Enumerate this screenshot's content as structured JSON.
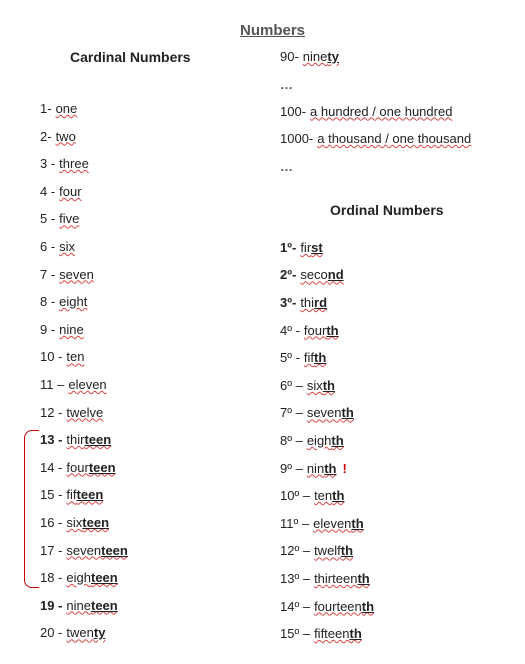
{
  "title": "Numbers",
  "cardinal": {
    "heading": "Cardinal Numbers",
    "items": [
      {
        "n": "1",
        "sep": "- ",
        "pre": "",
        "emph": "",
        "post": "one",
        "bold_num": false
      },
      {
        "n": "2",
        "sep": "- ",
        "pre": "",
        "emph": "",
        "post": "two",
        "bold_num": false
      },
      {
        "n": "3",
        "sep": " - ",
        "pre": "",
        "emph": "",
        "post": "three",
        "bold_num": false
      },
      {
        "n": "4",
        "sep": " - ",
        "pre": "",
        "emph": "",
        "post": "four",
        "bold_num": false
      },
      {
        "n": "5",
        "sep": " - ",
        "pre": "",
        "emph": "",
        "post": "five",
        "bold_num": false
      },
      {
        "n": "6",
        "sep": " - ",
        "pre": "",
        "emph": "",
        "post": "six",
        "bold_num": false
      },
      {
        "n": "7",
        "sep": " - ",
        "pre": "",
        "emph": "",
        "post": "seven",
        "bold_num": false
      },
      {
        "n": "8",
        "sep": " - ",
        "pre": "",
        "emph": "",
        "post": "eight",
        "bold_num": false
      },
      {
        "n": "9",
        "sep": " - ",
        "pre": "",
        "emph": "",
        "post": "nine",
        "bold_num": false
      },
      {
        "n": "10",
        "sep": " - ",
        "pre": "",
        "emph": "",
        "post": "ten",
        "bold_num": false
      },
      {
        "n": "11",
        "sep": " – ",
        "pre": "",
        "emph": "",
        "post": "eleven",
        "bold_num": false
      },
      {
        "n": "12",
        "sep": " - ",
        "pre": "",
        "emph": "",
        "post": "twelve",
        "bold_num": false
      },
      {
        "n": "13",
        "sep": " -",
        "pre": "thir",
        "emph": "teen",
        "post": "",
        "bold_num": true
      },
      {
        "n": "14",
        "sep": " - ",
        "pre": "four",
        "emph": "teen",
        "post": "",
        "bold_num": false
      },
      {
        "n": "15",
        "sep": " - ",
        "pre": "fif",
        "emph": "teen",
        "post": "",
        "bold_num": false
      },
      {
        "n": "16",
        "sep": " - ",
        "pre": "six",
        "emph": "teen",
        "post": "",
        "bold_num": false
      },
      {
        "n": "17",
        "sep": " - ",
        "pre": "seven",
        "emph": "teen",
        "post": "",
        "bold_num": false
      },
      {
        "n": "18",
        "sep": " - ",
        "pre": "eigh",
        "emph": "teen",
        "post": "",
        "bold_num": false
      },
      {
        "n": "19",
        "sep": " - ",
        "pre": "nine",
        "emph": "teen",
        "post": "",
        "bold_num": true
      },
      {
        "n": "20",
        "sep": " - ",
        "pre": "twen",
        "emph": "ty",
        "post": "",
        "bold_num": false
      }
    ]
  },
  "cardinal_extra": {
    "items": [
      {
        "n": "90",
        "sep": "- ",
        "pre": "nine",
        "emph": "ty",
        "post": "",
        "bold_num": false
      },
      {
        "ellipsis": "…"
      },
      {
        "n": "100",
        "sep": "- ",
        "pre": "",
        "emph": "",
        "post": "a hundred / one hundred",
        "bold_num": false
      },
      {
        "n": "1000",
        "sep": "- ",
        "pre": "",
        "emph": "",
        "post": "a thousand / one thousand",
        "bold_num": false
      },
      {
        "ellipsis": "…"
      }
    ]
  },
  "ordinal": {
    "heading": "Ordinal Numbers",
    "items": [
      {
        "n": "1º",
        "sep": "- ",
        "pre": "fir",
        "emph": "st",
        "post": "",
        "bold_num": true,
        "exclaim": false
      },
      {
        "n": "2º",
        "sep": "- ",
        "pre": "seco",
        "emph": "nd",
        "post": "",
        "bold_num": true,
        "exclaim": false
      },
      {
        "n": "3º",
        "sep": "- ",
        "pre": "thi",
        "emph": "rd",
        "post": "",
        "bold_num": true,
        "exclaim": false
      },
      {
        "n": "4º",
        "sep": " - ",
        "pre": "four",
        "emph": "th",
        "post": "",
        "bold_num": false,
        "exclaim": false
      },
      {
        "n": "5º",
        "sep": " - ",
        "pre": "fif",
        "emph": "th",
        "post": "",
        "bold_num": false,
        "exclaim": false
      },
      {
        "n": "6º",
        "sep": " – ",
        "pre": "six",
        "emph": "th",
        "post": "",
        "bold_num": false,
        "exclaim": false
      },
      {
        "n": "7º",
        "sep": " – ",
        "pre": "seven",
        "emph": "th",
        "post": "",
        "bold_num": false,
        "exclaim": false
      },
      {
        "n": "8º",
        "sep": " – ",
        "pre": "eigh",
        "emph": "th",
        "post": "",
        "bold_num": false,
        "exclaim": false
      },
      {
        "n": "9º",
        "sep": " – ",
        "pre": "nin",
        "emph": "th",
        "post": "",
        "bold_num": false,
        "exclaim": true
      },
      {
        "n": "10º",
        "sep": " – ",
        "pre": "ten",
        "emph": "th",
        "post": "",
        "bold_num": false,
        "exclaim": false
      },
      {
        "n": "11º",
        "sep": " – ",
        "pre": "eleven",
        "emph": "th",
        "post": "",
        "bold_num": false,
        "exclaim": false
      },
      {
        "n": "12º",
        "sep": " – ",
        "pre": "twelf",
        "emph": "th",
        "post": "",
        "bold_num": false,
        "exclaim": false
      },
      {
        "n": "13º",
        "sep": " – ",
        "pre": "thirteen",
        "emph": "th",
        "post": "",
        "bold_num": false,
        "exclaim": false
      },
      {
        "n": "14º",
        "sep": " – ",
        "pre": "fourteen",
        "emph": "th",
        "post": "",
        "bold_num": false,
        "exclaim": false
      },
      {
        "n": "15º",
        "sep": " – ",
        "pre": "fifteen",
        "emph": "th",
        "post": "",
        "bold_num": false,
        "exclaim": false
      }
    ]
  },
  "brace": {
    "start": 13,
    "end": 18
  }
}
